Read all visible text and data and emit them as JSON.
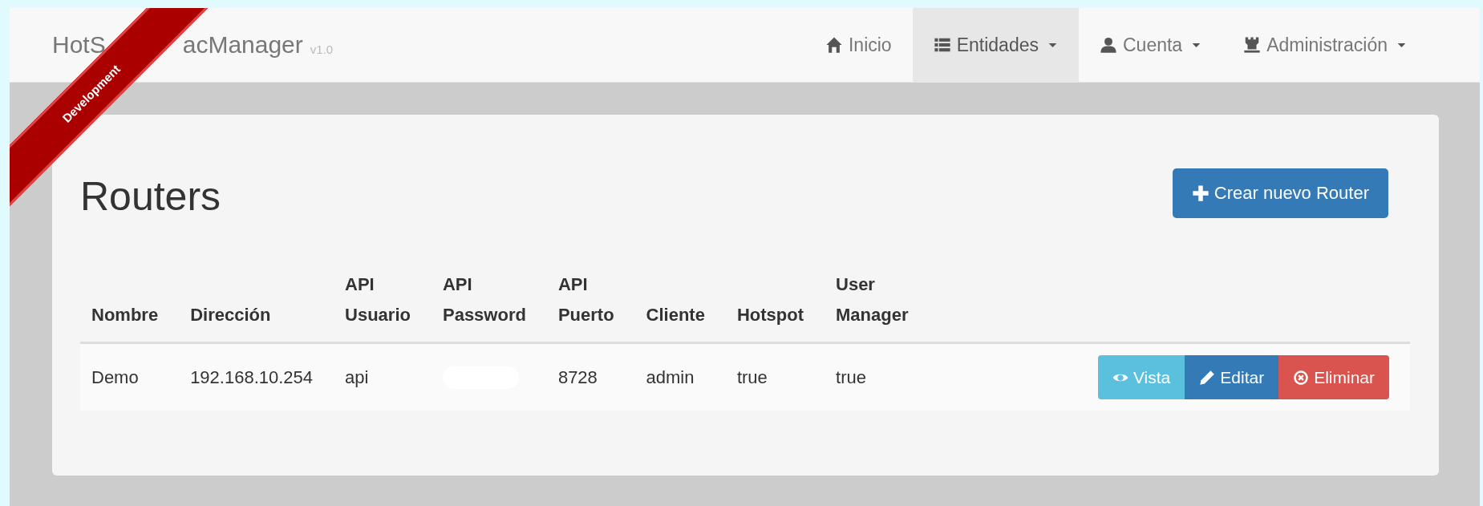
{
  "ribbon": {
    "label": "Development"
  },
  "navbar": {
    "brand_parts": [
      "HotS",
      "acManager"
    ],
    "version": "v1.0",
    "items": [
      {
        "label": "Inicio",
        "dropdown": false,
        "selected": false
      },
      {
        "label": "Entidades",
        "dropdown": true,
        "selected": true
      },
      {
        "label": "Cuenta",
        "dropdown": true,
        "selected": false
      },
      {
        "label": "Administración",
        "dropdown": true,
        "selected": false
      }
    ]
  },
  "page": {
    "title": "Routers",
    "create_button": "Crear nuevo Router"
  },
  "table": {
    "columns": [
      "Nombre",
      "Dirección",
      "API Usuario",
      "API Password",
      "API Puerto",
      "Cliente",
      "Hotspot",
      "User Manager"
    ],
    "rows": [
      {
        "cells": [
          {
            "kind": "text",
            "text": "Demo"
          },
          {
            "kind": "text",
            "text": "192.168.10.254"
          },
          {
            "kind": "text",
            "text": "api"
          },
          {
            "kind": "redacted"
          },
          {
            "kind": "text",
            "text": "8728"
          },
          {
            "kind": "text",
            "text": "admin"
          },
          {
            "kind": "text",
            "text": "true"
          },
          {
            "kind": "text",
            "text": "true"
          }
        ],
        "actions": [
          {
            "label": "Vista",
            "kind": "view"
          },
          {
            "label": "Editar",
            "kind": "edit"
          },
          {
            "label": "Eliminar",
            "kind": "delete"
          }
        ]
      }
    ]
  }
}
